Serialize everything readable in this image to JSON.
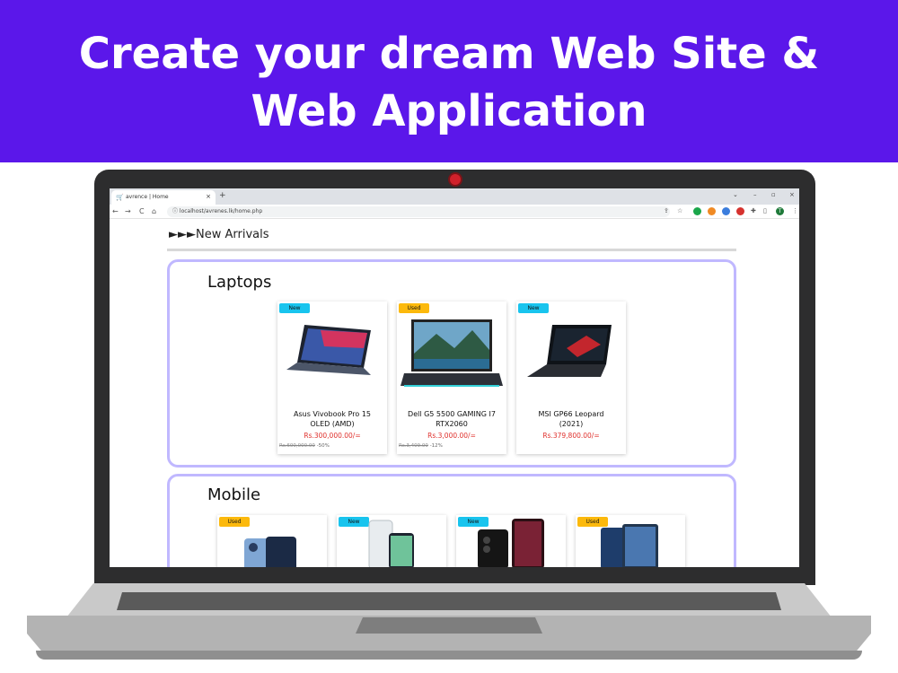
{
  "banner": {
    "line1": "Create your dream Web Site &",
    "line2": "Web Application",
    "color": "#5b17ea"
  },
  "browser": {
    "tab_title": "avrence | Home",
    "tab_close": "×",
    "new_tab": "+",
    "url": "localhost/avrenes.lk/home.php",
    "nav": {
      "back": "←",
      "forward": "→",
      "reload": "C",
      "home": "⌂"
    },
    "window_controls": {
      "chevron": "⌄",
      "minimize": "–",
      "restore": "▫",
      "close": "×"
    },
    "profile_initial": "T"
  },
  "page": {
    "section_heading": "►►►New Arrivals",
    "laptops": {
      "title": "Laptops",
      "products": [
        {
          "badge": "New",
          "badge_type": "new",
          "name_line1": "Asus Vivobook Pro 15",
          "name_line2": "OLED (AMD)",
          "price": "Rs.300,000.00/=",
          "old_price": "Rs.600,000.00",
          "discount": "-50%",
          "image": "laptop-dark-screen"
        },
        {
          "badge": "Used",
          "badge_type": "used",
          "name_line1": "Dell G5 5500 GAMING I7",
          "name_line2": "RTX2060",
          "price": "Rs.3,000.00/=",
          "old_price": "Rs.3,409.00",
          "discount": "-12%",
          "image": "laptop-lake-wallpaper"
        },
        {
          "badge": "New",
          "badge_type": "new",
          "name_line1": "MSI GP66 Leopard",
          "name_line2": "(2021)",
          "price": "Rs.379,800.00/=",
          "old_price": "",
          "discount": "",
          "image": "laptop-gaming"
        }
      ]
    },
    "mobile": {
      "title": "Mobile",
      "products": [
        {
          "badge": "Used",
          "badge_type": "used",
          "image": "iphone-blue"
        },
        {
          "badge": "New",
          "badge_type": "new",
          "image": "iphone-white"
        },
        {
          "badge": "New",
          "badge_type": "new",
          "image": "galaxy-ultra"
        },
        {
          "badge": "Used",
          "badge_type": "used",
          "image": "tablet-phone"
        }
      ]
    }
  }
}
